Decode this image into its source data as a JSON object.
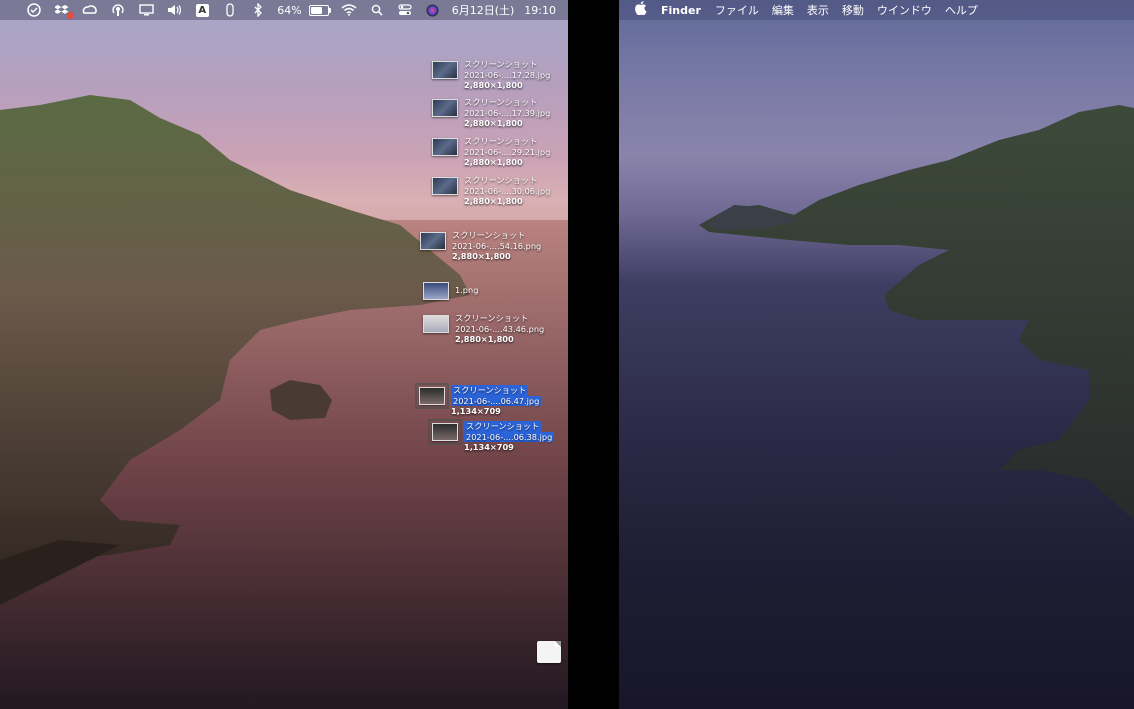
{
  "left_menubar": {
    "icons": [
      "creative-cloud-like-icon",
      "dropbox-icon",
      "adobe-icon",
      "podcast-icon",
      "airplay-display-icon",
      "volume-icon",
      "input-source-icon",
      "paperclip-icon",
      "bluetooth-icon"
    ],
    "input_source_letter": "A",
    "battery_percent": "64%",
    "battery_level": 0.64,
    "date": "6月12日(土)",
    "time": "19:10"
  },
  "right_menubar": {
    "app_name": "Finder",
    "menus": [
      "ファイル",
      "編集",
      "表示",
      "移動",
      "ウインドウ",
      "ヘルプ"
    ]
  },
  "desktop_items": [
    {
      "line1": "スクリーンショット",
      "line2": "2021-06-....17.28.jpg",
      "dims": "2,880×1,800",
      "selected": false
    },
    {
      "line1": "スクリーンショット",
      "line2": "2021-06-....17.39.jpg",
      "dims": "2,880×1,800",
      "selected": false
    },
    {
      "line1": "スクリーンショット",
      "line2": "2021-06-....29.21.jpg",
      "dims": "2,880×1,800",
      "selected": false
    },
    {
      "line1": "スクリーンショット",
      "line2": "2021-06-....30.06.jpg",
      "dims": "2,880×1,800",
      "selected": false
    },
    {
      "line1": "スクリーンショット",
      "line2": "2021-06-....54.16.png",
      "dims": "2,880×1,800",
      "selected": false
    },
    {
      "line1": "1.png",
      "line2": "",
      "dims": "",
      "selected": false
    },
    {
      "line1": "スクリーンショット",
      "line2": "2021-06-....43.46.png",
      "dims": "2,880×1,800",
      "selected": false
    },
    {
      "line1": "スクリーンショット",
      "line2": "2021-06-....06.47.jpg",
      "dims": "1,134×709",
      "selected": true
    },
    {
      "line1": "スクリーンショット",
      "line2": "2021-06-....06.38.jpg",
      "dims": "1,134×709",
      "selected": true
    }
  ]
}
